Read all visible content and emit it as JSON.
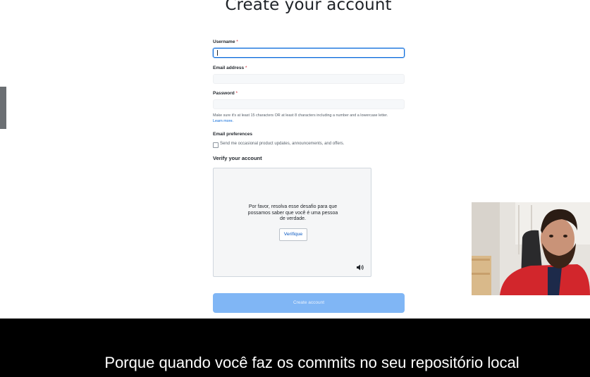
{
  "title": "Create your account",
  "form": {
    "username_label": "Username",
    "email_label": "Email address",
    "password_label": "Password",
    "required_mark": "*",
    "password_hint": "Make sure it's at least 15 characters OR at least 8 characters including a number and a lowercase letter.",
    "learn_more": "Learn more.",
    "email_prefs_title": "Email preferences",
    "email_prefs_option": "Send me occasional product updates, announcements, and offers.",
    "email_prefs_checked": false,
    "verify_title": "Verify your account",
    "submit_label": "Create account"
  },
  "captcha": {
    "line1": "Por favor, resolva esse desafio para que",
    "line2": "possamos saber que você é uma pessoa",
    "line3": "de verdade.",
    "button_label": "Verifique",
    "audio_icon": "speaker-icon"
  },
  "subtitle": {
    "text": "Porque quando você faz os commits no seu repositório local"
  },
  "colors": {
    "accent": "#0969da",
    "submit_disabled": "#80b6f5",
    "subtitle_bg": "#000000"
  }
}
